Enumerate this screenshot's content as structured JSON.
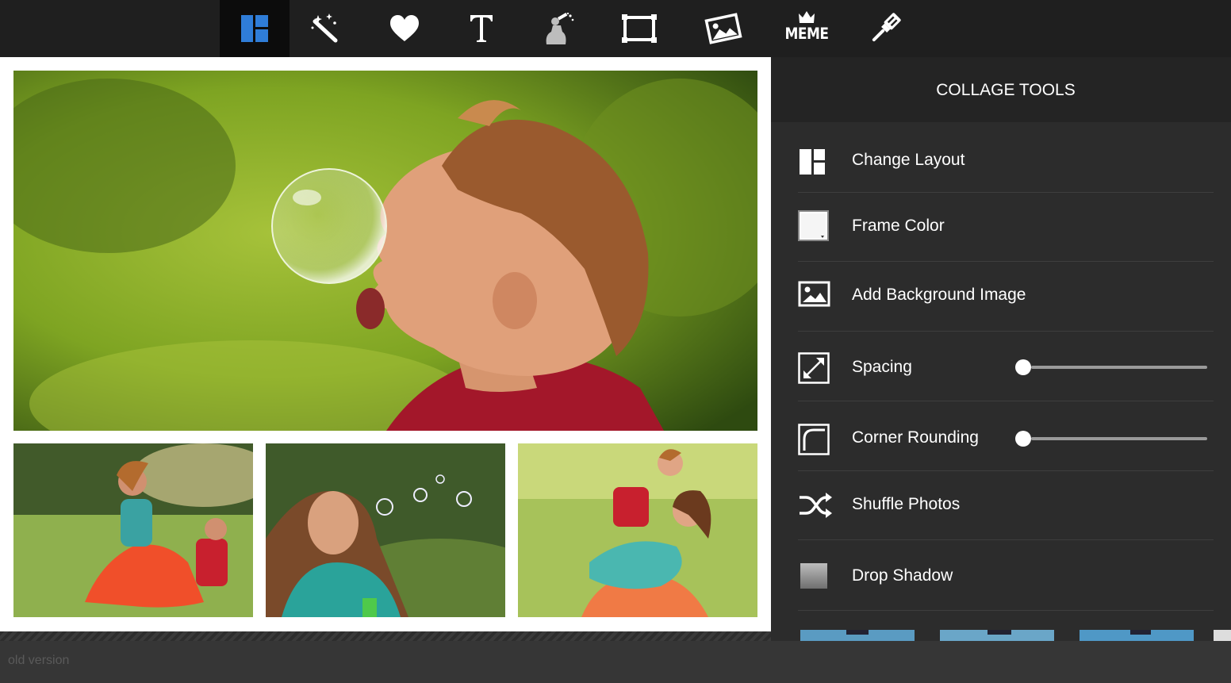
{
  "toolbar": {
    "tools": [
      {
        "name": "collage-layout-icon",
        "active": true
      },
      {
        "name": "magic-wand-icon",
        "active": false
      },
      {
        "name": "heart-icon",
        "active": false
      },
      {
        "name": "text-icon",
        "active": false
      },
      {
        "name": "spray-paint-icon",
        "active": false
      },
      {
        "name": "frame-icon",
        "active": false
      },
      {
        "name": "photo-overlay-icon",
        "active": false
      },
      {
        "name": "meme-icon",
        "active": false
      },
      {
        "name": "brush-icon",
        "active": false
      }
    ],
    "meme_label": "MEME",
    "active_color": "#2f7dd8"
  },
  "panel": {
    "title": "COLLAGE TOOLS",
    "items": [
      {
        "label": "Change Layout",
        "icon": "layout-icon"
      },
      {
        "label": "Frame Color",
        "icon": "color-swatch-icon"
      },
      {
        "label": "Add Background Image",
        "icon": "image-icon"
      },
      {
        "label": "Spacing",
        "icon": "resize-diagonal-icon",
        "slider_value": 0
      },
      {
        "label": "Corner Rounding",
        "icon": "corner-round-icon",
        "slider_value": 0
      },
      {
        "label": "Shuffle Photos",
        "icon": "shuffle-icon"
      },
      {
        "label": "Drop Shadow",
        "icon": "shadow-icon"
      }
    ]
  },
  "footer": {
    "link": "old version"
  },
  "colors": {
    "toolbar_bg": "#1f1f1f",
    "panel_bg": "#2c2c2c",
    "canvas_frame": "#ffffff"
  }
}
